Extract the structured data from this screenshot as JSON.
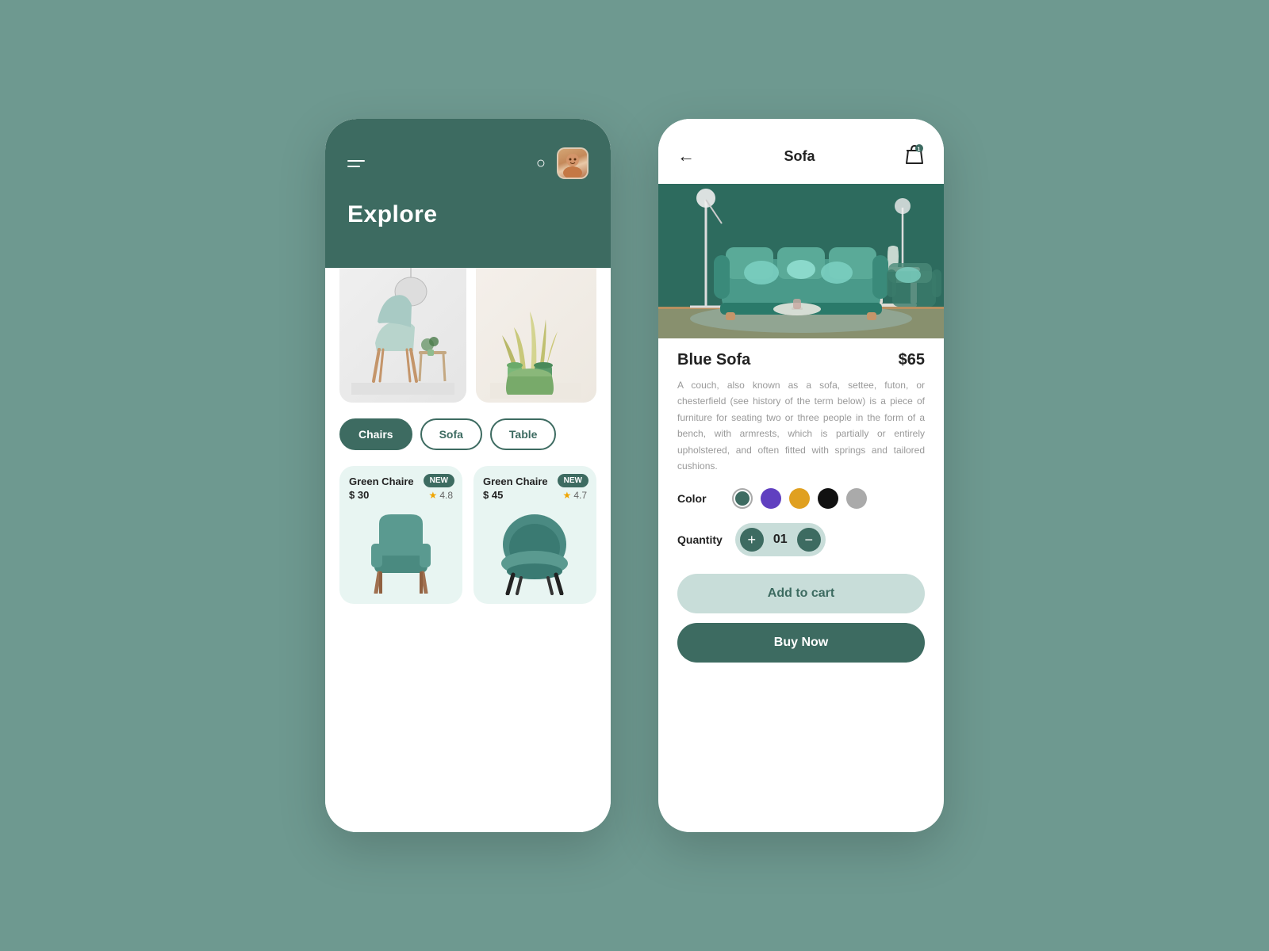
{
  "left_phone": {
    "header": {
      "title": "Explore"
    },
    "avatar_emoji": "👤",
    "categories": [
      {
        "id": "chairs",
        "label": "Chairs",
        "active": true
      },
      {
        "id": "sofa",
        "label": "Sofa",
        "active": false
      },
      {
        "id": "table",
        "label": "Table",
        "active": false
      }
    ],
    "products": [
      {
        "name": "Green Chaire",
        "price": "$ 30",
        "rating": "4.8",
        "badge": "NEW",
        "color": "#b2d8d0"
      },
      {
        "name": "Green Chaire",
        "price": "$ 45",
        "rating": "4.7",
        "badge": "NEW",
        "color": "#b2d8d0"
      }
    ]
  },
  "right_phone": {
    "title": "Sofa",
    "product": {
      "name": "Blue Sofa",
      "price": "$65",
      "description": "A couch, also known as a sofa, settee, futon, or chesterfield (see history of the term below) is a piece of furniture for seating two or three people in the form of a bench, with armrests, which is partially or entirely upholstered, and often fitted with springs and tailored cushions.",
      "quantity": "01"
    },
    "colors": [
      {
        "hex": "#3d6b61",
        "selected": true
      },
      {
        "hex": "#6040c0",
        "selected": false
      },
      {
        "hex": "#e0a020",
        "selected": false
      },
      {
        "hex": "#111111",
        "selected": false
      },
      {
        "hex": "#aaaaaa",
        "selected": false
      }
    ],
    "buttons": {
      "add_to_cart": "Add to cart",
      "buy_now": "Buy Now"
    },
    "labels": {
      "color": "Color",
      "quantity": "Quantity"
    }
  }
}
